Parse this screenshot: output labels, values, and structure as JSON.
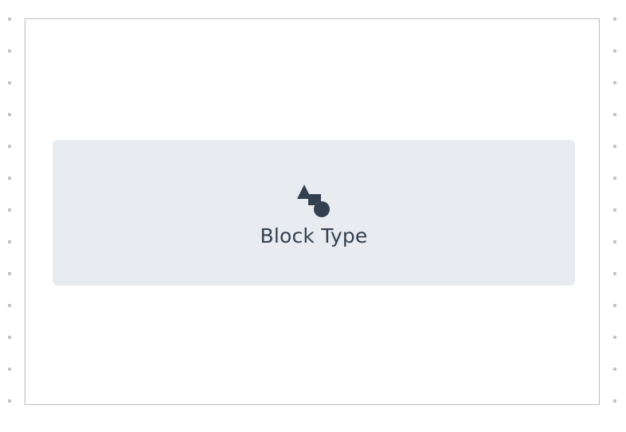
{
  "placeholder": {
    "label": "Block Type",
    "icon": "shapes-icon"
  },
  "colors": {
    "placeholder_background": "#e8ebf0",
    "text": "#344050",
    "frame_border": "#bdbdbd",
    "guide_dots": "#c4c4c4"
  }
}
